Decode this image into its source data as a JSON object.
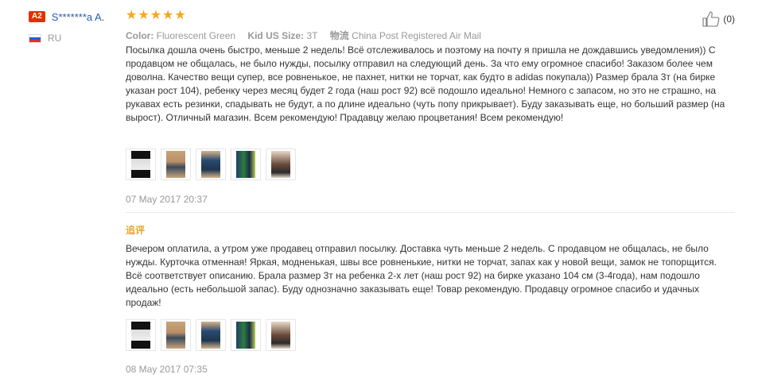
{
  "reviewer": {
    "level": "A2",
    "name": "S*******a A.",
    "country": "RU",
    "flag_colors": [
      "#ffffff",
      "#2a5bd7",
      "#e0302c"
    ]
  },
  "rating": {
    "stars": 5,
    "color": "#f6a623"
  },
  "attributes": [
    {
      "label": "Color:",
      "value": "Fluorescent Green"
    },
    {
      "label": "Kid US Size:",
      "value": "3T"
    },
    {
      "label": "物流",
      "value": "China Post Registered Air Mail"
    }
  ],
  "helpful": {
    "count": "(0)",
    "icon": "thumbs-up-icon"
  },
  "review": {
    "text": "Посылка дошла очень быстро, меньше 2 недель! Всё отслеживалось и поэтому на почту я пришла не дождавшись уведомления)) С продавцом не общалась, не было нужды, посылку отправил на следующий день. За что ему огромное спасибо! Заказом более чем доволна. Качество вещи супер, все ровненькое, не пахнет, нитки не торчат, как будто в adidas покупала)) Размер брала 3т (на бирке указан рост 104), ребенку через месяц будет 2 года (наш рост 92) всё подошло идеально! Немного с запасом, но это не страшно, на рукавах есть резинки, спадывать не будут, а по длине идеально (чуть попу прикрывает). Буду заказывать еще, но больший размер (на вырост). Отличный магазин. Всем рекомендую! Прадавцу желаю процветания! Всем рекомендую!",
    "photos": [
      "photo-1",
      "photo-2",
      "photo-3",
      "photo-4",
      "photo-5"
    ],
    "date": "07 May 2017 20:37"
  },
  "additional_review": {
    "label": "追评",
    "text": "Вечером оплатила, а утром уже продавец отправил посылку. Доставка чуть меньше 2 недель. С продавцом не общалась, не было нужды. Курточка отменная! Яркая, модненькая, швы все ровненькие, нитки не торчат, запах как у новой вещи, замок не топорщится. Всё соответствует описанию. Брала размер 3т на ребенка 2-х лет (наш рост 92) на бирке указано 104 см (3-4года), нам подошло идеально (есть небольшой запас). Буду однозначно заказывать еще! Товар рекомендую. Продавцу огромное спасибо и удачных продаж!",
    "photos": [
      "photo-1",
      "photo-2",
      "photo-3",
      "photo-4",
      "photo-5"
    ],
    "date": "08 May 2017 07:35"
  }
}
